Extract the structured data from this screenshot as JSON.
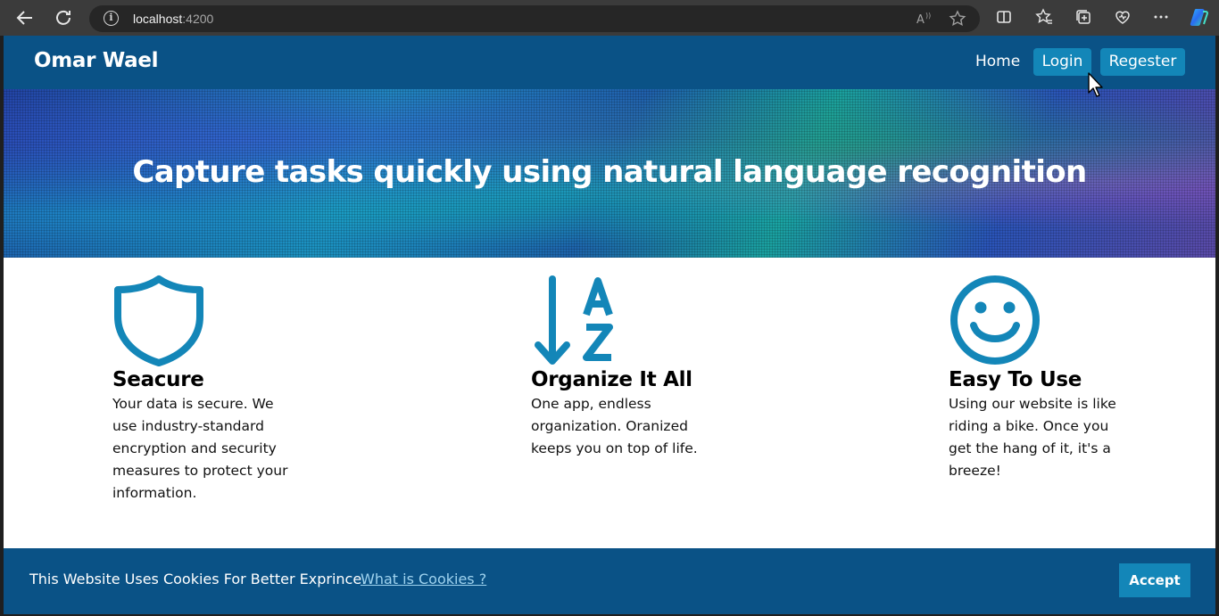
{
  "browser": {
    "url_host": "localhost",
    "url_port": ":4200",
    "icons": [
      "back-arrow-icon",
      "reload-icon",
      "site-info-icon",
      "read-aloud-icon",
      "favorite-star-icon",
      "split-screen-icon",
      "favorites-icon",
      "collections-icon",
      "browser-essentials-icon",
      "more-icon",
      "copilot-icon"
    ]
  },
  "navbar": {
    "brand": "Omar Wael",
    "links": {
      "home": "Home",
      "login": "Login",
      "register": "Regester"
    }
  },
  "hero": {
    "headline": "Capture tasks quickly using natural language recognition"
  },
  "features": [
    {
      "icon": "shield-icon",
      "title": "Seacure",
      "text": "Your data is secure. We use industry-standard encryption and security measures to protect your information."
    },
    {
      "icon": "sort-a-z-icon",
      "title": "Organize It All",
      "text": "One app, endless organization. Oranized keeps you on top of life."
    },
    {
      "icon": "smiley-face-icon",
      "title": "Easy To Use",
      "text": "Using our website is like riding a bike. Once you get the hang of it, it's a breeze!"
    }
  ],
  "cookie_banner": {
    "message": "This Website Uses Cookies For Better Exprince.",
    "link": "What is Cookies ?",
    "accept": "Accept"
  },
  "colors": {
    "navbar": "#0a5286",
    "accent": "#1386b8",
    "browser_chrome": "#3b3b3b"
  }
}
